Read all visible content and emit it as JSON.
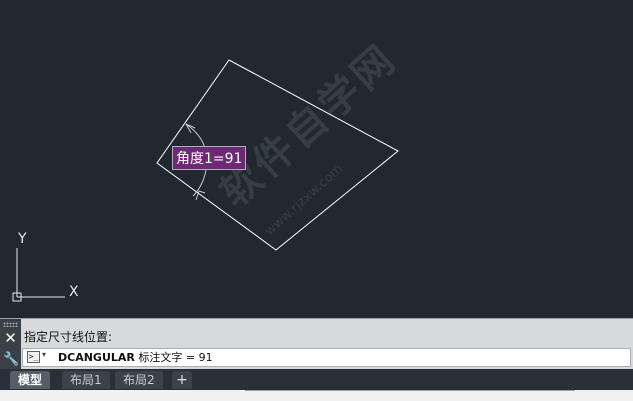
{
  "drawing": {
    "dimension_label": "角度1=91",
    "ucs": {
      "y_label": "Y",
      "x_label": "X"
    }
  },
  "watermark": {
    "text": "软件自学网",
    "url": "www.rjzxw.com"
  },
  "command": {
    "history": "指定尺寸线位置:",
    "prompt_icon": ">_",
    "prompt_caret": "▾",
    "name": "DCANGULAR",
    "rest": " 标注文字 = 91"
  },
  "tabs": {
    "model": "模型",
    "layout1": "布局1",
    "layout2": "布局2",
    "add": "+"
  },
  "colors": {
    "canvas": "#212830",
    "dimension_fill": "#6b2a73",
    "panel": "#d7dadd"
  }
}
